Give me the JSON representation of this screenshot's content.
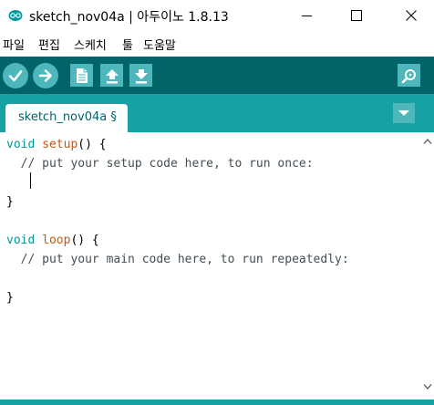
{
  "window": {
    "title": "sketch_nov04a | 아두이노 1.8.13",
    "minimize_icon": "minimize-icon",
    "maximize_icon": "maximize-icon",
    "close_icon": "close-icon"
  },
  "menu": {
    "items": [
      "파일",
      "편집",
      "스케치",
      "툴",
      "도움말"
    ]
  },
  "toolbar": {
    "buttons": [
      "verify-icon",
      "upload-icon",
      "new-icon",
      "open-icon",
      "save-icon"
    ],
    "serial_monitor_icon": "serial-monitor-icon",
    "accent_color": "#006468",
    "button_color": "#4db7bb"
  },
  "tabs": {
    "items": [
      {
        "label": "sketch_nov04a §"
      }
    ],
    "menu_icon": "tab-menu-icon",
    "strip_color": "#17a1a5"
  },
  "editor": {
    "lines": [
      {
        "parts": [
          {
            "t": "void",
            "c": "kw-void"
          },
          {
            "t": " "
          },
          {
            "t": "setup",
            "c": "kw-func"
          },
          {
            "t": "() {"
          }
        ]
      },
      {
        "parts": [
          {
            "t": "  // put your setup code here, to run once:",
            "c": "comment"
          }
        ]
      },
      {
        "parts": [
          {
            "t": ""
          }
        ]
      },
      {
        "parts": [
          {
            "t": "}"
          }
        ]
      },
      {
        "parts": [
          {
            "t": ""
          }
        ]
      },
      {
        "parts": [
          {
            "t": "void",
            "c": "kw-void"
          },
          {
            "t": " "
          },
          {
            "t": "loop",
            "c": "kw-func"
          },
          {
            "t": "() {"
          }
        ]
      },
      {
        "parts": [
          {
            "t": "  // put your main code here, to run repeatedly:",
            "c": "comment"
          }
        ]
      },
      {
        "parts": [
          {
            "t": ""
          }
        ]
      },
      {
        "parts": [
          {
            "t": "}"
          }
        ]
      }
    ],
    "colors": {
      "keyword": "#00979c",
      "function": "#d35400",
      "comment": "#434f54"
    }
  }
}
